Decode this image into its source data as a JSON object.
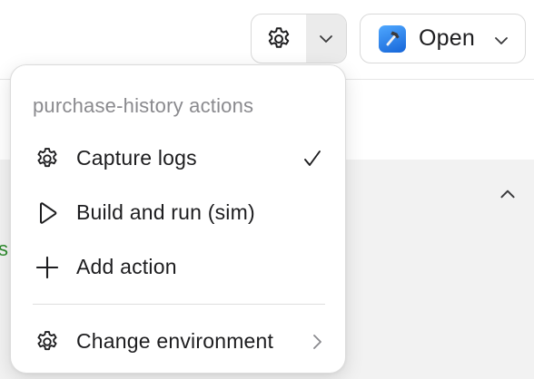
{
  "toolbar": {
    "settings_split": {
      "icon": "gear-icon",
      "dropdown_icon": "chevron-down-icon"
    },
    "open_button": {
      "label": "Open",
      "app_icon": "xcode-hammer-icon",
      "dropdown_icon": "chevron-down-icon"
    }
  },
  "background": {
    "status_fragment": "s",
    "status_color": "#2e8b2e",
    "collapse_icon": "chevron-up-icon"
  },
  "menu": {
    "header": "purchase-history actions",
    "items": [
      {
        "label": "Capture logs",
        "icon": "gear-icon",
        "checked": true
      },
      {
        "label": "Build and run (sim)",
        "icon": "play-icon",
        "checked": false
      },
      {
        "label": "Add action",
        "icon": "plus-icon",
        "checked": false
      }
    ],
    "footer_item": {
      "label": "Change environment",
      "icon": "gear-icon",
      "submenu_icon": "chevron-right-icon"
    }
  },
  "colors": {
    "accent_blue": "#1665d8",
    "text_primary": "#1d1d1f",
    "text_secondary": "#8a8a8e"
  }
}
